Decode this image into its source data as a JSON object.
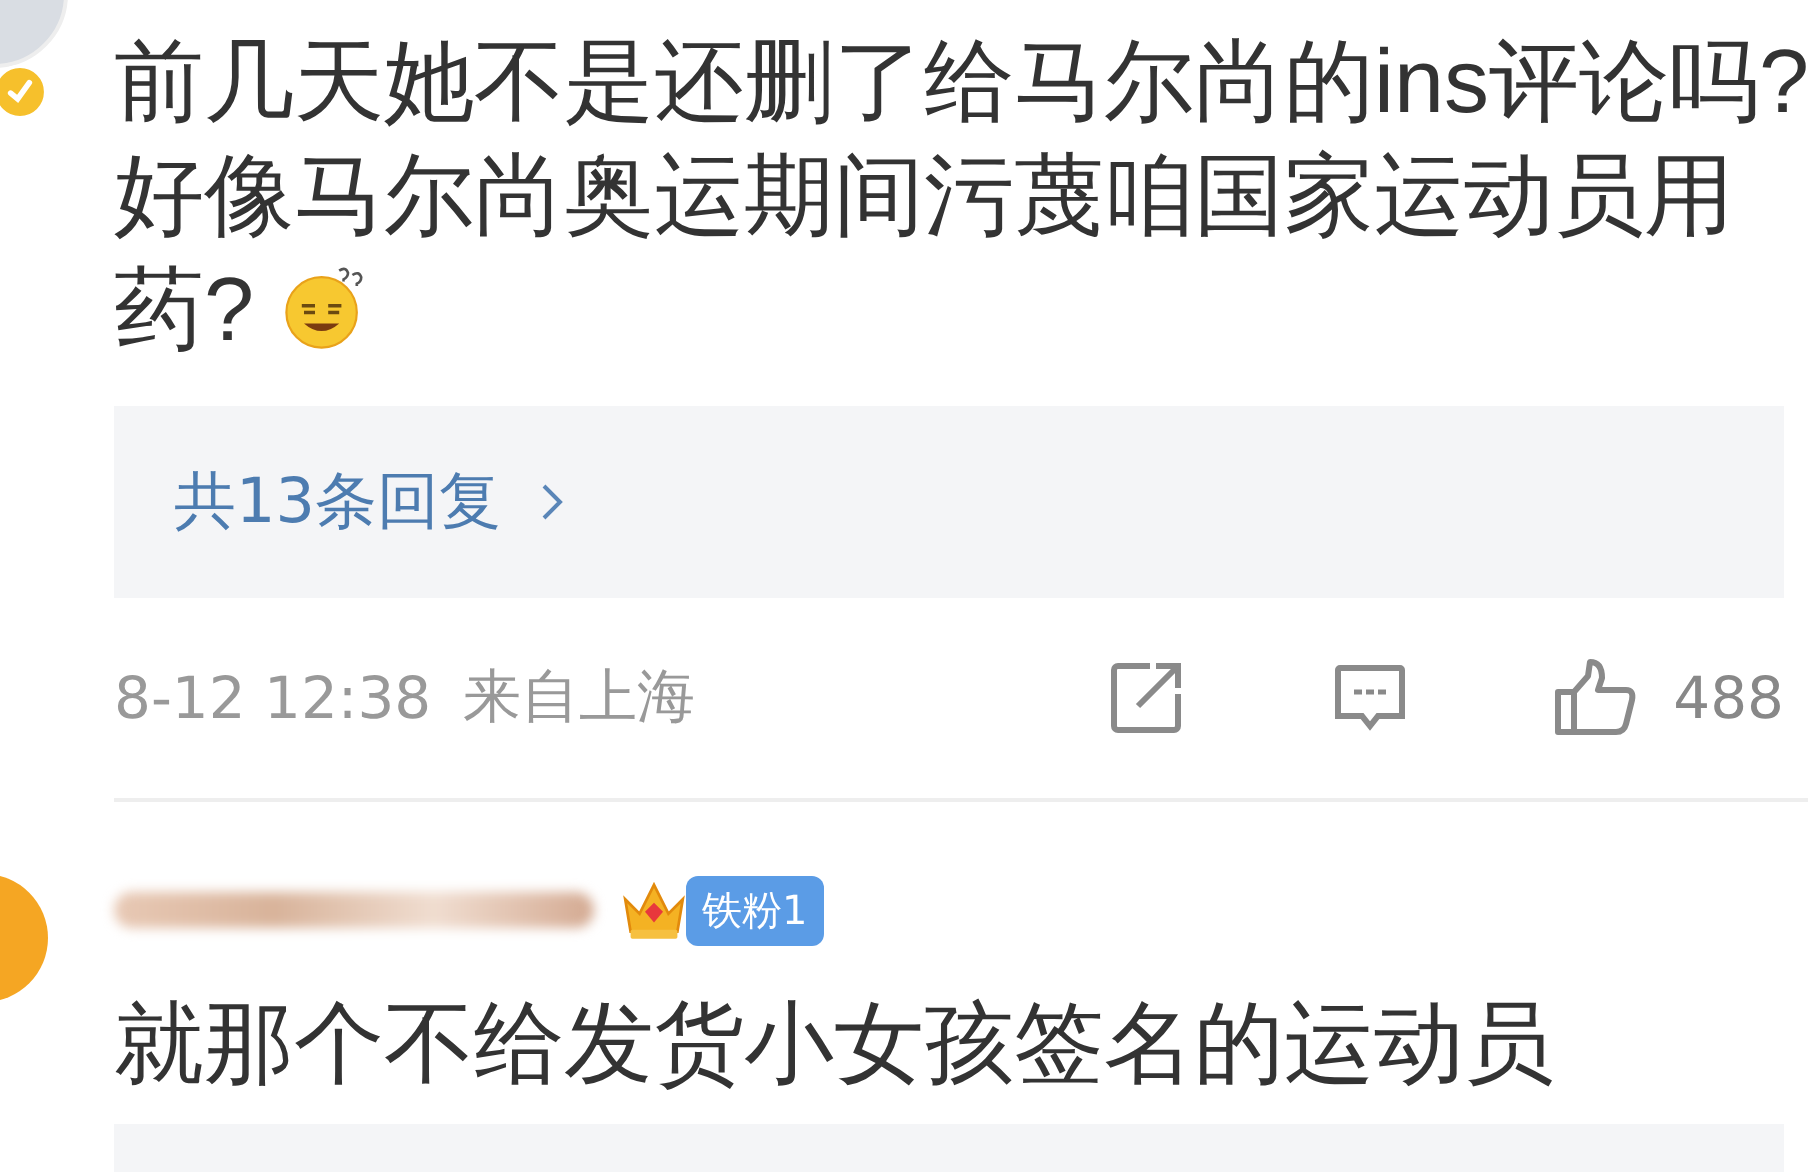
{
  "comments": [
    {
      "text": "前几天她不是还删了给马尔尚的ins评论吗?好像马尔尚奥运期间污蔑咱国家运动员用药?",
      "verified": true,
      "replies": {
        "label": "共13条回复"
      },
      "time": "8-12 12:38",
      "location": "来自上海",
      "likes": "488"
    },
    {
      "text": "就那个不给发货小女孩签名的运动员",
      "badge": {
        "label": "铁粉1"
      }
    }
  ]
}
